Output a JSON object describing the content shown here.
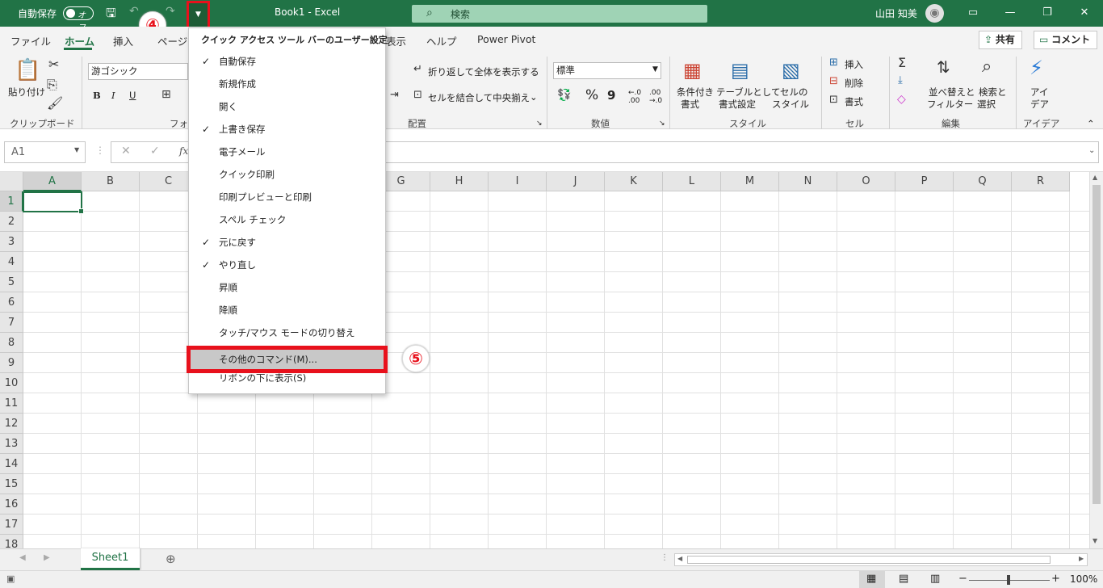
{
  "titlebar": {
    "autosave_label": "自動保存",
    "autosave_state": "オフ",
    "doc_title": "Book1  -  Excel",
    "search_placeholder": "検索",
    "user_name": "山田 知美",
    "annotation_4": "④",
    "annotation_5": "⑤"
  },
  "tabs": [
    "ファイル",
    "ホーム",
    "挿入",
    "ページ",
    "表示",
    "ヘルプ",
    "Power Pivot"
  ],
  "active_tab": "ホーム",
  "share_button": "共有",
  "comment_button": "コメント",
  "ribbon": {
    "clipboard": {
      "paste": "貼り付け",
      "label": "クリップボード"
    },
    "font": {
      "name": "游ゴシック",
      "bold": "B",
      "italic": "I",
      "underline": "U",
      "label": "フォン"
    },
    "alignment": {
      "wrap": "折り返して全体を表示する",
      "merge": "セルを結合して中央揃え",
      "label": "配置"
    },
    "number": {
      "format": "標準",
      "percent": "%",
      "comma": "9",
      "label": "数値"
    },
    "styles": {
      "cond1": "条件付き",
      "cond2": "書式",
      "table1": "テーブルとして",
      "table2": "書式設定",
      "cell1": "セルの",
      "cell2": "スタイル",
      "label": "スタイル"
    },
    "cells": {
      "insert": "挿入",
      "delete": "削除",
      "format": "書式",
      "label": "セル"
    },
    "editing": {
      "sort1": "並べ替えと",
      "sort2": "フィルター",
      "find1": "検索と",
      "find2": "選択",
      "label": "編集"
    },
    "ideas": {
      "l1": "アイ",
      "l2": "デア",
      "label": "アイデア"
    }
  },
  "formula_bar": {
    "name_box": "A1",
    "fx": "fx"
  },
  "columns": [
    "A",
    "B",
    "C",
    "D",
    "E",
    "F",
    "G",
    "H",
    "I",
    "J",
    "K",
    "L",
    "M",
    "N",
    "O",
    "P",
    "Q",
    "R"
  ],
  "rows": [
    "1",
    "2",
    "3",
    "4",
    "5",
    "6",
    "7",
    "8",
    "9",
    "10",
    "11",
    "12",
    "13",
    "14",
    "15",
    "16",
    "17",
    "18"
  ],
  "sheet_tab": "Sheet1",
  "zoom": "100%",
  "menu": {
    "title": "クイック アクセス ツール バーのユーザー設定",
    "items": [
      {
        "label": "自動保存",
        "checked": true
      },
      {
        "label": "新規作成",
        "checked": false
      },
      {
        "label": "開く",
        "checked": false
      },
      {
        "label": "上書き保存",
        "checked": true
      },
      {
        "label": "電子メール",
        "checked": false
      },
      {
        "label": "クイック印刷",
        "checked": false
      },
      {
        "label": "印刷プレビューと印刷",
        "checked": false
      },
      {
        "label": "スペル チェック",
        "checked": false
      },
      {
        "label": "元に戻す",
        "checked": true
      },
      {
        "label": "やり直し",
        "checked": true
      },
      {
        "label": "昇順",
        "checked": false
      },
      {
        "label": "降順",
        "checked": false
      },
      {
        "label": "タッチ/マウス モードの切り替え",
        "checked": false
      },
      {
        "label": "その他のコマンド(M)...",
        "checked": false
      },
      {
        "label": "リボンの下に表示(S)",
        "checked": false
      }
    ]
  }
}
